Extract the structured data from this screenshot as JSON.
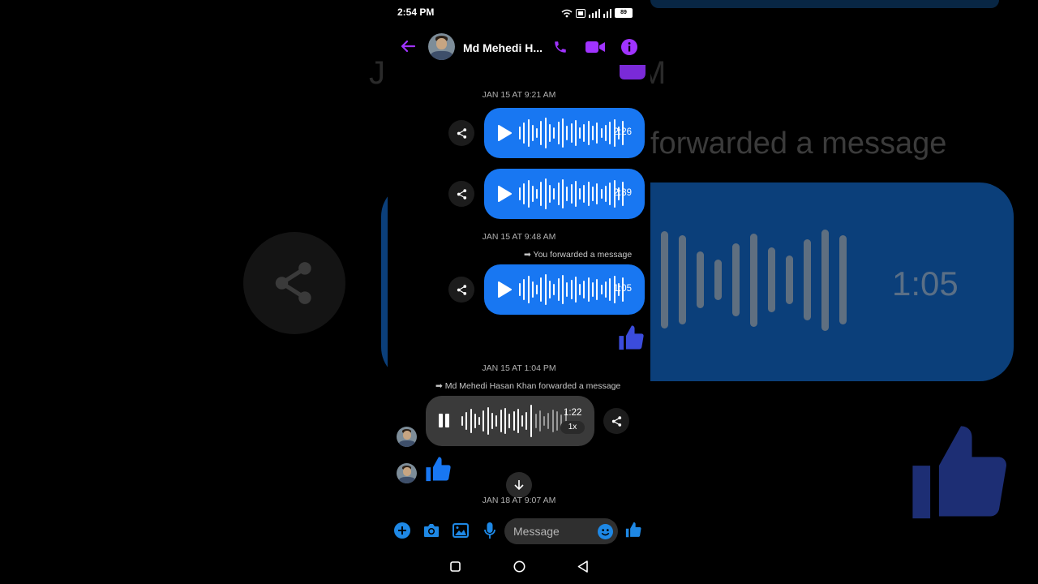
{
  "status_bar": {
    "time": "2:54 PM",
    "battery": "89"
  },
  "header": {
    "contact_name": "Md Mehedi H..."
  },
  "messages": {
    "date_1": "JAN 15 AT 9:21 AM",
    "voice_1_duration": "2:26",
    "voice_2_duration": "2:39",
    "date_2": "JAN 15 AT 9:48 AM",
    "forward_note_1": "You forwarded a message",
    "voice_3_duration": "1:05",
    "date_3": "JAN 15 AT 1:04 PM",
    "forward_note_2": "Md Mehedi Hasan Khan forwarded a message",
    "voice_4_duration": "1:22",
    "voice_4_speed": "1x",
    "date_4": "JAN 18 AT 9:07 AM"
  },
  "composer": {
    "placeholder": "Message"
  },
  "background": {
    "date_fragment_left": "J",
    "date_fragment_right": "M",
    "forward_text": "forwarded a message",
    "voice_duration": "1:05"
  },
  "colors": {
    "accent_purple": "#a033ff",
    "bubble_blue": "#1877f2",
    "composer_blue": "#1e88e5",
    "received_bubble": "#3a3a3a"
  }
}
